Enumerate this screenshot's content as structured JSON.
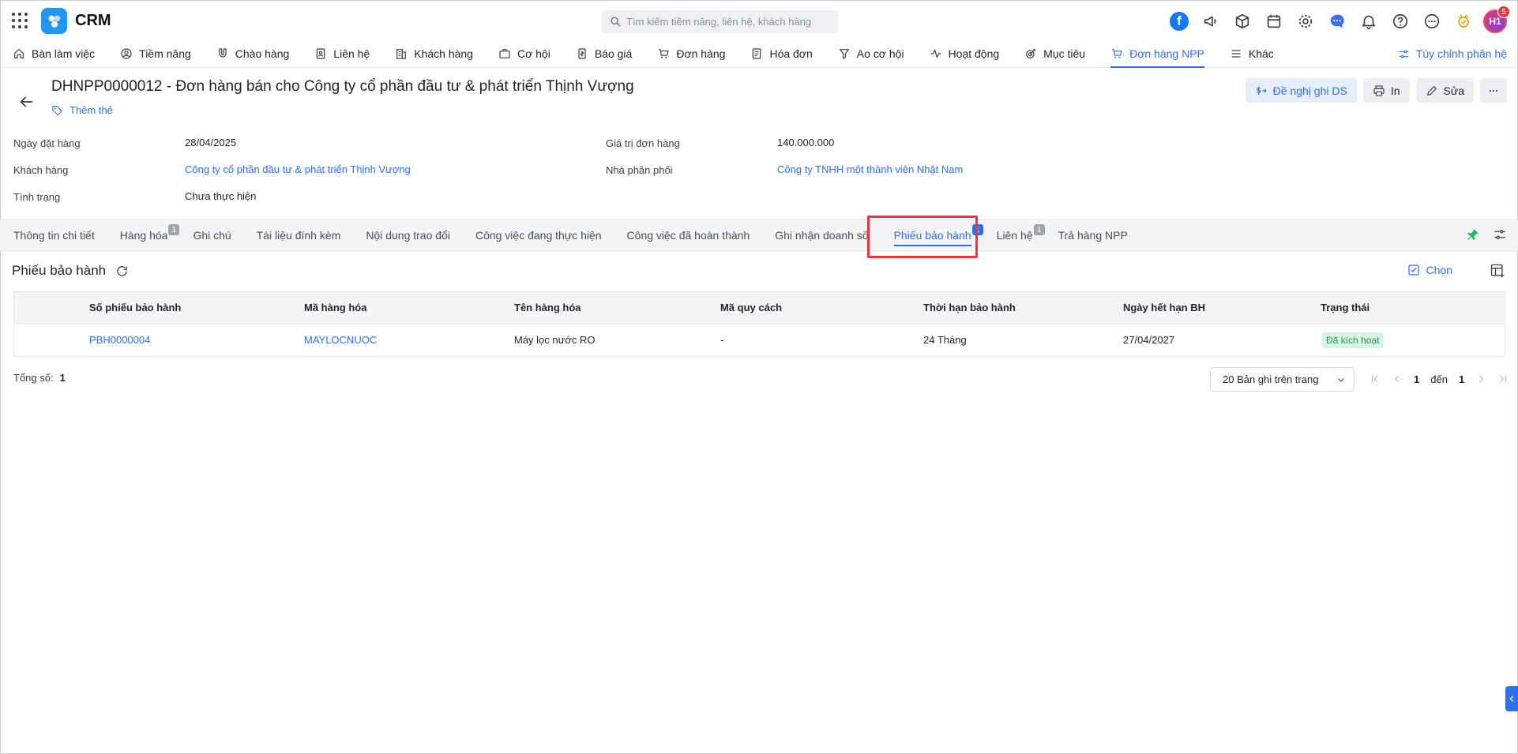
{
  "app": {
    "name": "CRM"
  },
  "search": {
    "placeholder": "Tìm kiếm tiềm năng, liên hệ, khách hàng"
  },
  "topbar": {
    "notification_count": "5",
    "avatar_initials": "H1",
    "facebook_label": "f"
  },
  "nav": {
    "items": [
      {
        "label": "Bàn làm việc",
        "icon": "home-icon"
      },
      {
        "label": "Tiềm năng",
        "icon": "lead-icon"
      },
      {
        "label": "Chào hàng",
        "icon": "magnet-icon"
      },
      {
        "label": "Liên hệ",
        "icon": "contact-icon"
      },
      {
        "label": "Khách hàng",
        "icon": "building-icon"
      },
      {
        "label": "Cơ hội",
        "icon": "briefcase-icon"
      },
      {
        "label": "Báo giá",
        "icon": "quote-icon"
      },
      {
        "label": "Đơn hàng",
        "icon": "cart-icon"
      },
      {
        "label": "Hóa đơn",
        "icon": "invoice-icon"
      },
      {
        "label": "Ao cơ hội",
        "icon": "funnel-icon"
      },
      {
        "label": "Hoạt động",
        "icon": "activity-icon"
      },
      {
        "label": "Mục tiêu",
        "icon": "target-icon"
      },
      {
        "label": "Đơn hàng NPP",
        "icon": "cart-dist-icon",
        "active": true
      },
      {
        "label": "Khác",
        "icon": "menu-icon"
      }
    ],
    "customize_label": "Tùy chỉnh phân hệ"
  },
  "record": {
    "title": "DHNPP0000012 - Đơn hàng bán cho Công ty cổ phần đầu tư & phát triển Thịnh Vượng",
    "add_tag": "Thêm thẻ",
    "actions": {
      "suggest": "Đề nghị ghi DS",
      "print": "In",
      "edit": "Sửa"
    }
  },
  "info": {
    "order_date_label": "Ngày đặt hàng",
    "order_date": "28/04/2025",
    "order_value_label": "Giá trị đơn hàng",
    "order_value": "140.000.000",
    "customer_label": "Khách hàng",
    "customer": "Công ty cổ phần đầu tư & phát triển Thịnh Vượng",
    "distributor_label": "Nhà phân phối",
    "distributor": "Công ty TNHH một thành viên Nhật Nam",
    "status_label": "Tình trạng",
    "status": "Chưa thực hiện"
  },
  "tabs": [
    {
      "label": "Thông tin chi tiết"
    },
    {
      "label": "Hàng hóa",
      "count": "1"
    },
    {
      "label": "Ghi chú"
    },
    {
      "label": "Tài liệu đính kèm"
    },
    {
      "label": "Nội dung trao đổi"
    },
    {
      "label": "Công việc đang thực hiện"
    },
    {
      "label": "Công việc đã hoàn thành"
    },
    {
      "label": "Ghi nhận doanh số"
    },
    {
      "label": "Phiếu bảo hành",
      "count": "1",
      "active": true
    },
    {
      "label": "Liên hệ",
      "count": "1"
    },
    {
      "label": "Trả hàng NPP"
    }
  ],
  "section": {
    "title": "Phiếu bảo hành",
    "choose_label": "Chọn"
  },
  "table": {
    "columns": [
      "Số phiếu bảo hành",
      "Mã hàng hóa",
      "Tên hàng hóa",
      "Mã quy cách",
      "Thời hạn bảo hành",
      "Ngày hết hạn BH",
      "Trạng thái"
    ],
    "rows": [
      [
        "PBH0000004",
        "MAYLOCNUOC",
        "Máy lọc nước RO",
        "-",
        "24 Tháng",
        "27/04/2027",
        "Đã kích hoạt"
      ]
    ]
  },
  "footer": {
    "total_label": "Tổng số:",
    "total": "1",
    "page_size": "20 Bản ghi trên trang",
    "page_from": "1",
    "to_label": "đến",
    "page_to": "1"
  },
  "colors": {
    "accent": "#2f6fed",
    "highlight": "#e8373f",
    "active_status_bg": "#d9f2e3",
    "active_status_text": "#1e9e57"
  }
}
